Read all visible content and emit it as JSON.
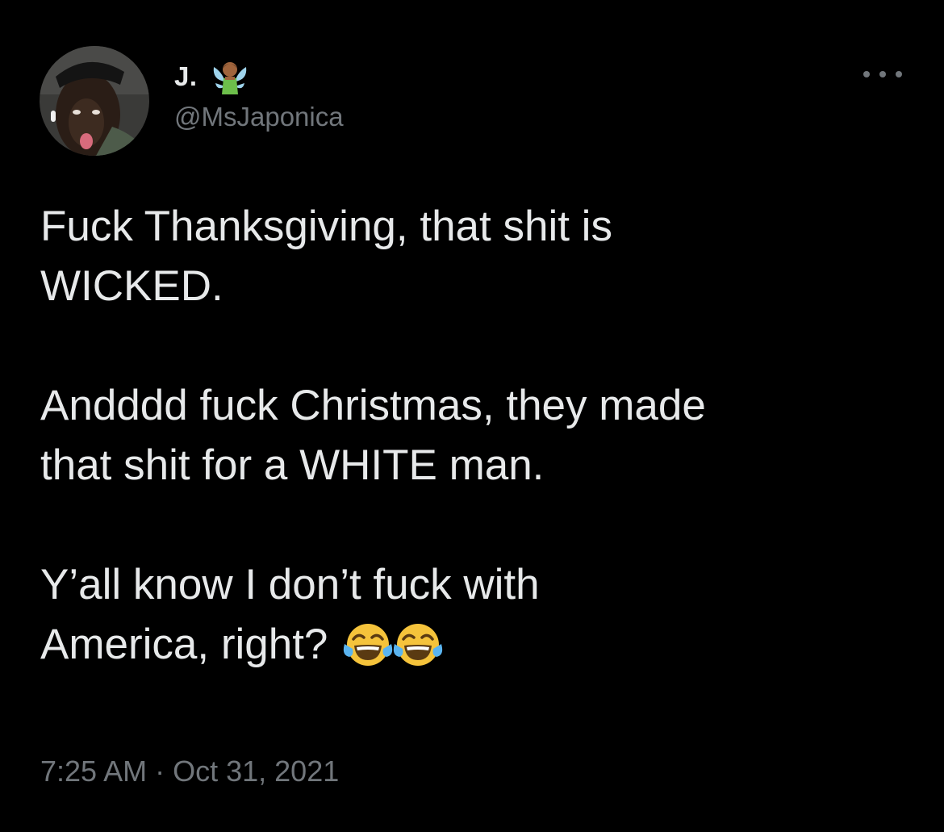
{
  "tweet": {
    "author": {
      "display_name": "J.",
      "name_emoji": "fairy-emoji",
      "handle": "@MsJaponica"
    },
    "more_icon": "more-horizontal-icon",
    "text_lines": {
      "line1": "Fuck Thanksgiving, that shit is",
      "line2": "WICKED.",
      "line3": "Andddd fuck Christmas, they made",
      "line4": "that shit for a WHITE man.",
      "line5": "Y’all know I don’t fuck with",
      "line6": "America, right?"
    },
    "text_emoji": "face-with-tears-of-joy-emoji",
    "time": "7:25 AM",
    "separator": " · ",
    "date": "Oct 31, 2021"
  },
  "colors": {
    "background": "#000000",
    "primary_text": "#e7e9ea",
    "secondary_text": "#71767b"
  }
}
